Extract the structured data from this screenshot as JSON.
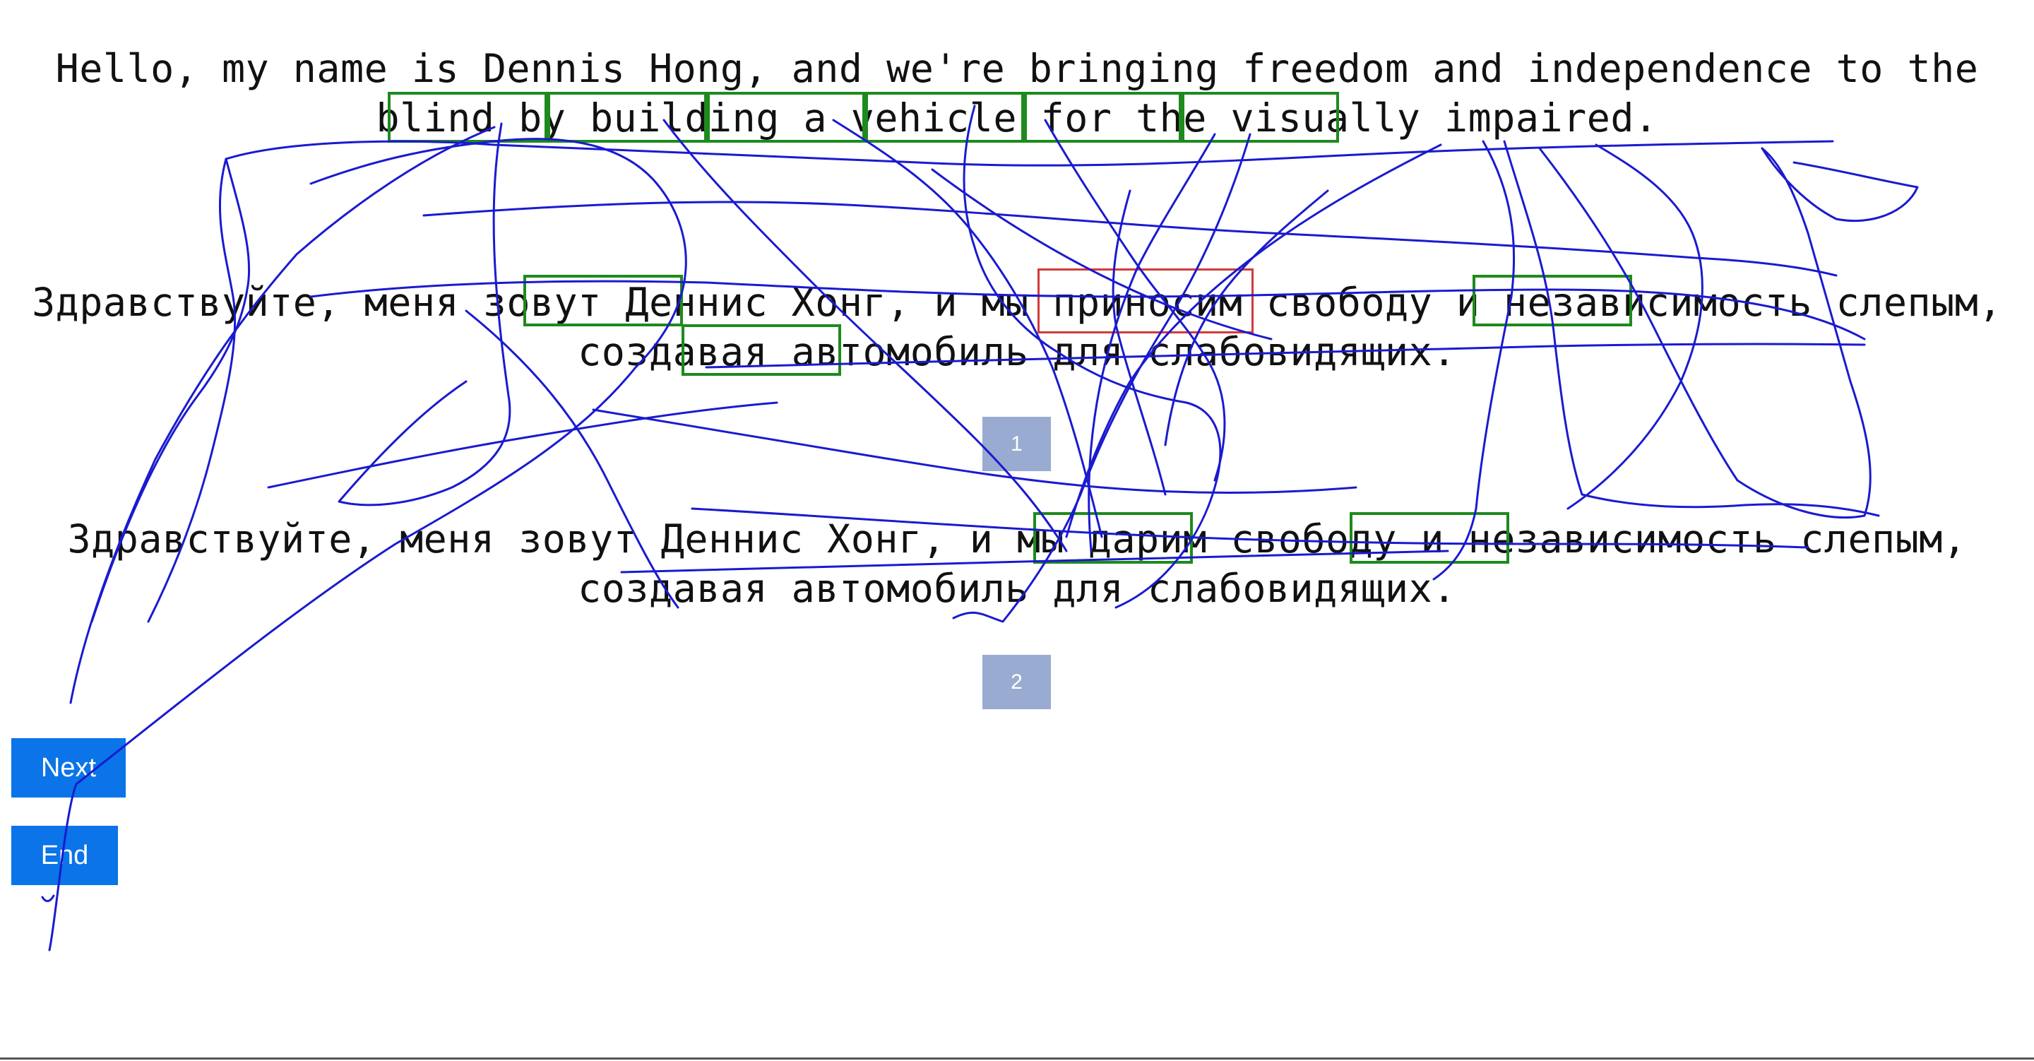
{
  "source_sentence": {
    "line1": "Hello, my name is Dennis Hong, and we're bringing freedom and independence to the",
    "line2": "blind by building a vehicle for the visually impaired."
  },
  "translation_1": {
    "line1": "Здравствуйте, меня зовут Деннис Хонг, и мы приносим свободу и независимость слепым,",
    "line2": "создавая автомобиль для слабовидящих.",
    "marker": "1"
  },
  "translation_2": {
    "line1": "Здравствуйте, меня зовут Деннис Хонг, и мы дарим свободу и независимость слепым,",
    "line2": "создавая автомобиль для слабовидящих.",
    "marker": "2"
  },
  "buttons": {
    "next_label": "Next",
    "end_label": "End"
  },
  "colors": {
    "highlight_good": "#1e8a1e",
    "highlight_bad": "#d23a3a",
    "scribble": "#1a1ad0",
    "button": "#0a74e8",
    "marker": "#9aabd1"
  }
}
